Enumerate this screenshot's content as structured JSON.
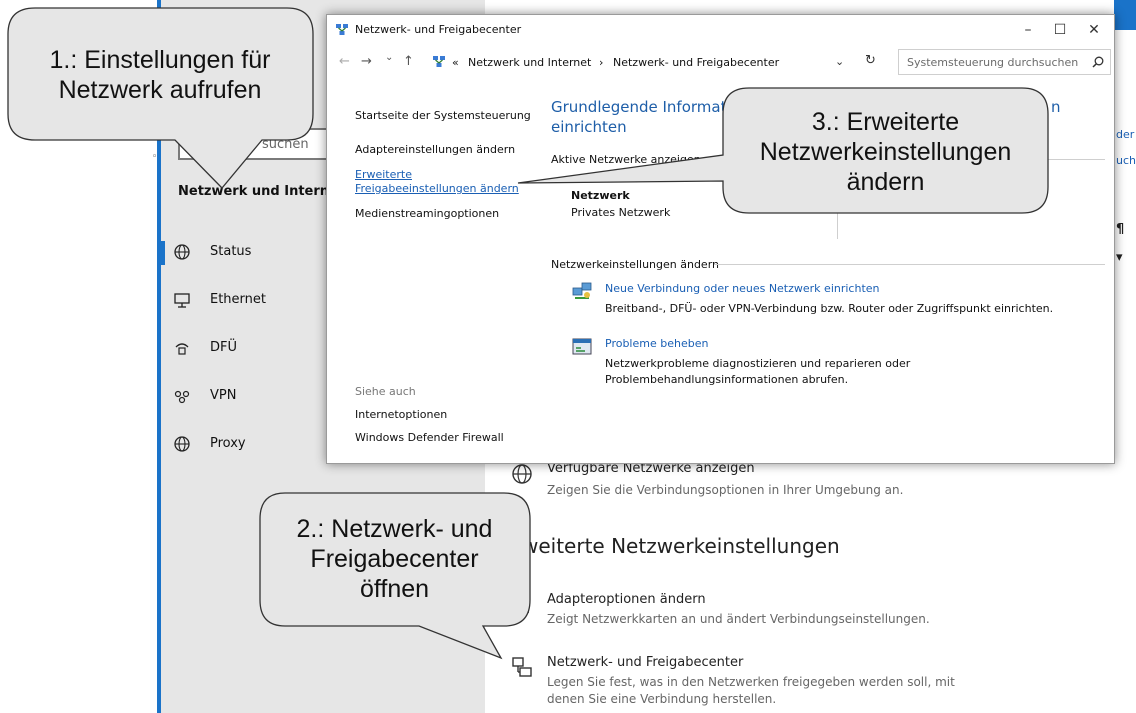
{
  "settings": {
    "search_placeholder": "suchen",
    "nav_heading": "Netzwerk und Internet",
    "nav_items": [
      {
        "icon": "globe-icon",
        "label": "Status"
      },
      {
        "icon": "ethernet-icon",
        "label": "Ethernet"
      },
      {
        "icon": "dialup-icon",
        "label": "DFÜ"
      },
      {
        "icon": "vpn-icon",
        "label": "VPN"
      },
      {
        "icon": "proxy-globe-icon",
        "label": "Proxy"
      }
    ],
    "right_edge_fragments": [
      "der",
      "uch"
    ],
    "available_networks": {
      "title": "Verfügbare Netzwerke anzeigen",
      "subtitle": "Zeigen Sie die Verbindungsoptionen in Ihrer Umgebung an."
    },
    "advanced_heading": "weiterte Netzwerkeinstellungen",
    "adapter_options": {
      "title": "Adapteroptionen ändern",
      "subtitle": "Zeigt Netzwerkkarten an und ändert Verbindungseinstellungen."
    },
    "sharing_center": {
      "title": "Netzwerk- und Freigabecenter",
      "subtitle_1": "Legen Sie fest, was in den Netzwerken freigegeben werden soll, mit",
      "subtitle_2": "denen Sie eine Verbindung herstellen."
    }
  },
  "control_panel": {
    "window_title": "Netzwerk- und Freigabecenter",
    "window_buttons": {
      "minimize": "–",
      "maximize": "☐",
      "close": "✕"
    },
    "nav": {
      "back": "←",
      "forward": "→",
      "recent": "⌄",
      "up": "↑"
    },
    "breadcrumb": {
      "overflow": "«",
      "items": [
        "Netzwerk und Internet",
        "Netzwerk- und Freigabecenter"
      ],
      "separator": "›"
    },
    "address_dropdown": "⌄",
    "refresh": "↻",
    "search_placeholder": "Systemsteuerung durchsuchen",
    "left_links": {
      "home": "Startseite der Systemsteuerung",
      "adapter": "Adaptereinstellungen ändern",
      "advanced_1": "Erweiterte",
      "advanced_2": "Freigabeeinstellungen ändern",
      "media": "Medienstreamingoptionen"
    },
    "see_also": {
      "label": "Siehe auch",
      "items": [
        "Internetoptionen",
        "Windows Defender Firewall"
      ]
    },
    "main_title_1": "Grundlegende Informatio",
    "main_title_end": "n",
    "main_title_2": "einrichten",
    "active_networks_label": "Aktive Netzwerke anzeigen",
    "network": {
      "name": "Netzwerk",
      "type": "Privates Netzwerk"
    },
    "change_settings_label": "Netzwerkeinstellungen ändern",
    "tasks": [
      {
        "icon": "new-connection-icon",
        "link": "Neue Verbindung oder neues Netzwerk einrichten",
        "desc": "Breitband-, DFÜ- oder VPN-Verbindung bzw. Router oder Zugriffspunkt einrichten."
      },
      {
        "icon": "troubleshoot-icon",
        "link": "Probleme beheben",
        "desc": "Netzwerkprobleme diagnostizieren und reparieren oder Problembehandlungsinformationen abrufen."
      }
    ]
  },
  "callouts": {
    "one": [
      "1.: Einstellungen für",
      "Netzwerk aufrufen"
    ],
    "two": [
      "2.: Netzwerk- und",
      "Freigabecenter",
      "öffnen"
    ],
    "three": [
      "3.: Erweiterte",
      "Netzwerkeinstellungen",
      "ändern"
    ]
  },
  "colors": {
    "accent": "#1a73c9",
    "link": "#1a5fb4",
    "callout_fill": "#e6e6e6",
    "sidebar": "#e6e6e6"
  }
}
